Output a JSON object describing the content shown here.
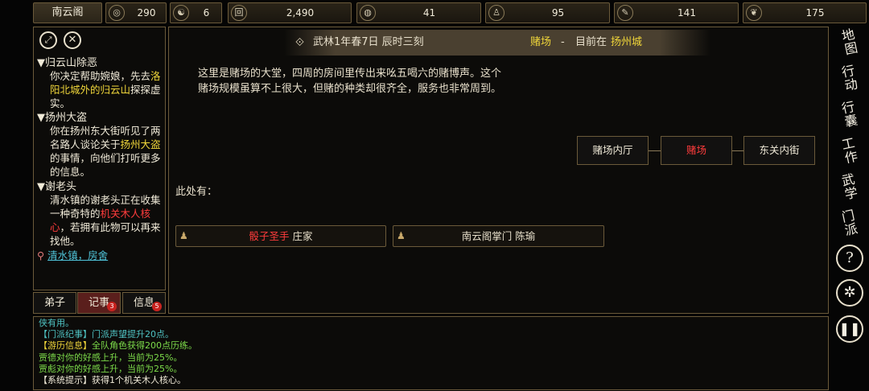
{
  "top_bar": {
    "sect_name": "南云阁",
    "resources": [
      {
        "icon": "coin-pouch-icon",
        "glyph": "◎",
        "value": "290"
      },
      {
        "icon": "yin-yang-icon",
        "glyph": "☯",
        "value": "6"
      },
      {
        "icon": "copper-coin-icon",
        "glyph": "回",
        "value": "2,490"
      },
      {
        "icon": "rice-bowl-icon",
        "glyph": "◍",
        "value": "41"
      },
      {
        "icon": "figure-icon",
        "glyph": "♙",
        "value": "95"
      },
      {
        "icon": "scroll-icon",
        "glyph": "✎",
        "value": "141"
      },
      {
        "icon": "beast-icon",
        "glyph": "❦",
        "value": "175"
      }
    ]
  },
  "header": {
    "date": "武林1年春7日 辰时三刻",
    "location_name": "赌场",
    "separator": "-",
    "current_prefix": "目前在",
    "city": "扬州城"
  },
  "description_line1": "这里是赌场的大堂，四周的房间里传出来吆五喝六的赌博声。这个",
  "description_line2": "赌场规模虽算不上很大，但赌的种类却很齐全，服务也非常周到。",
  "rooms": {
    "left": "赌场内厅",
    "center": "赌场",
    "right": "东关内街"
  },
  "here_label": "此处有：",
  "npcs": [
    {
      "title": "骰子圣手",
      "name": "庄家"
    },
    {
      "title": "南云阁掌门",
      "name": "陈瑜"
    }
  ],
  "quests": [
    {
      "title": "▼归云山除恶",
      "parts": [
        "你决定帮助婉娘，先去",
        "洛阳北城外的归云山",
        "探探虚实。"
      ]
    },
    {
      "title": "▼扬州大盗",
      "parts": [
        "你在扬州东大街听见了两名路人谈论关于",
        "扬州大盗",
        "的事情，向他们打听更多的信息。"
      ]
    },
    {
      "title": "▼谢老头",
      "parts": [
        "清水镇的谢老头正在收集一种奇特的",
        "机关木人核心",
        "，若拥有此物可以再来找他。"
      ],
      "location": "清水镇，房舍"
    }
  ],
  "tabs": [
    {
      "label": "弟子",
      "badge": ""
    },
    {
      "label": "记事",
      "badge": "3"
    },
    {
      "label": "信息",
      "badge": "5"
    }
  ],
  "log": [
    {
      "color": "#4fc3c3",
      "text": "侠有用。"
    },
    {
      "color": "#4fc3c3",
      "text": "【门派纪事】门派声望提升20点。"
    },
    {
      "color": "#7ddc4a",
      "prefix": "【游历信息】",
      "prefix_color": "#f0d63a",
      "text": "全队角色获得200点历练。"
    },
    {
      "color": "#7ddc4a",
      "text": "贾德对你的好感上升，当前为25%。"
    },
    {
      "color": "#7ddc4a",
      "text": "贾彪对你的好感上升，当前为25%。"
    },
    {
      "color": "#f0ead8",
      "text": "【系统提示】获得1个机关木人核心。"
    }
  ],
  "right_menu": [
    "地图",
    "行动",
    "行囊",
    "工作",
    "武学",
    "门派"
  ],
  "colors": {
    "gold": "#f0d63a",
    "red": "#ff3c3c",
    "cyan": "#4fc3c3",
    "green": "#7ddc4a",
    "border": "#6b5a3a"
  }
}
